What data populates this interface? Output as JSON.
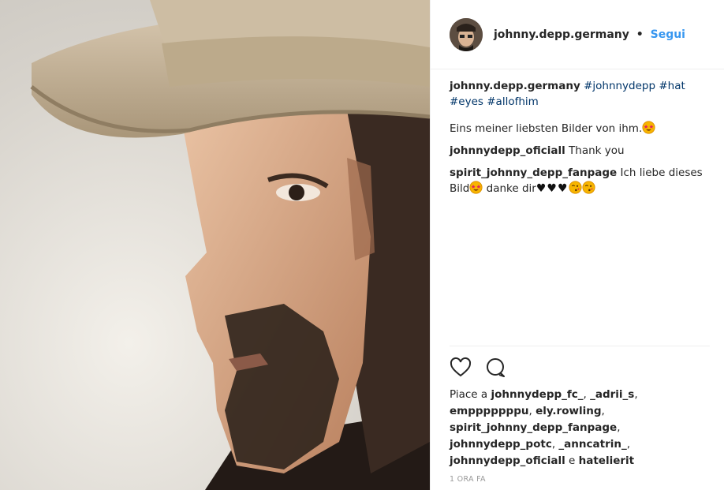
{
  "post": {
    "username": "johnny.depp.germany",
    "separator": "•",
    "follow_label": "Segui",
    "caption": {
      "user": "johnny.depp.germany",
      "tags": [
        "#johnnydepp",
        "#hat",
        "#eyes",
        "#allofhim"
      ],
      "text": "Eins meiner liebsten Bilder von ihm."
    },
    "comments": [
      {
        "user": "johnnydepp_oficiall",
        "text": "Thank you"
      },
      {
        "user": "spirit_johnny_depp_fanpage",
        "text_a": "Ich liebe dieses Bild",
        "text_b": " danke dir"
      }
    ],
    "likes": {
      "prefix": "Piace a",
      "users": [
        "johnnydepp_fc_",
        "_adrii_s",
        "empppppppu",
        "ely.rowling",
        "spirit_johnny_depp_fanpage",
        "johnnydepp_potc",
        "_anncatrin_",
        "johnnydepp_oficiall"
      ],
      "and": "e",
      "last": "hatelierit"
    },
    "timestamp": "1 ORA FA"
  },
  "icons": {
    "like": "heart-outline-icon",
    "comment": "comment-bubble-icon",
    "emoji_star_eyes": "star-struck-emoji-icon",
    "emoji_kiss": "kissing-face-emoji-icon"
  },
  "colors": {
    "link_blue": "#3897f0",
    "hashtag": "#003569",
    "text": "#262626",
    "muted": "#999999"
  }
}
